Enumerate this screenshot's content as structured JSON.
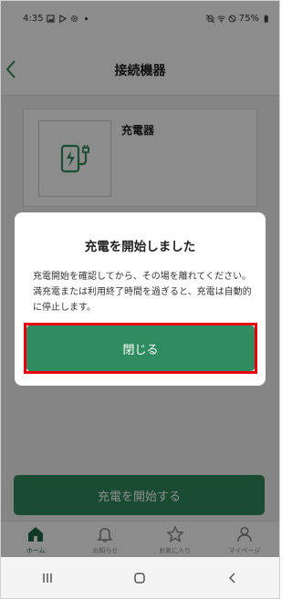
{
  "status_bar": {
    "time": "4:35",
    "battery": "75%"
  },
  "header": {
    "title": "接続機器"
  },
  "device": {
    "name": "充電器"
  },
  "main_button": {
    "label": "充電を開始する"
  },
  "dialog": {
    "title": "充電を開始しました",
    "message": "充電開始を確認してから、その場を離れてください。満充電または利用終了時間を過ぎると、充電は自動的に停止します。",
    "close_label": "閉じる"
  },
  "tabs": [
    {
      "label": "ホーム",
      "icon": "home-icon",
      "active": true
    },
    {
      "label": "お知らせ",
      "icon": "bell-icon",
      "active": false
    },
    {
      "label": "お気に入り",
      "icon": "star-icon",
      "active": false
    },
    {
      "label": "マイページ",
      "icon": "person-icon",
      "active": false
    }
  ],
  "colors": {
    "accent": "#2f8c60",
    "highlight": "#e8000f"
  }
}
